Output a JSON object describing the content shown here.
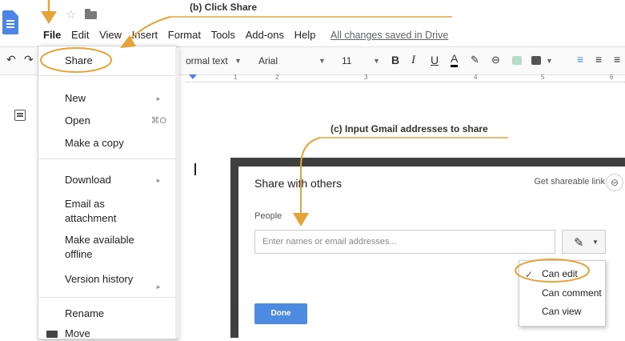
{
  "menubar": {
    "items": [
      "File",
      "Edit",
      "View",
      "Insert",
      "Format",
      "Tools",
      "Add-ons",
      "Help"
    ],
    "saved_status": "All changes saved in Drive"
  },
  "toolbar": {
    "style": "ormal text",
    "font": "Arial",
    "size": "11",
    "bold": "B",
    "italic": "I",
    "underline": "U",
    "text_color": "A"
  },
  "ruler": {
    "ticks": [
      "1",
      "2",
      "3",
      "4",
      "5",
      "6"
    ]
  },
  "file_menu": {
    "share": "Share",
    "new": "New",
    "open": "Open",
    "open_shortcut": "⌘O",
    "make_copy": "Make a copy",
    "download": "Download",
    "email_line1": "Email as",
    "email_line2": "attachment",
    "offline_line1": "Make available",
    "offline_line2": "offline",
    "version_history": "Version history",
    "rename": "Rename",
    "move": "Move"
  },
  "share_dialog": {
    "title": "Share with others",
    "shareable_link": "Get shareable link",
    "people_label": "People",
    "input_placeholder": "Enter names or email addresses...",
    "done": "Done",
    "permissions": [
      "Can edit",
      "Can comment",
      "Can view"
    ],
    "selected_permission": "Can edit"
  },
  "annotations": {
    "step_b": "(b) Click Share",
    "step_c": "(c) Input Gmail addresses to share"
  },
  "colors": {
    "annotation": "#e6a33a",
    "docs_blue": "#4a86e8",
    "done_button": "#4d8be0"
  }
}
